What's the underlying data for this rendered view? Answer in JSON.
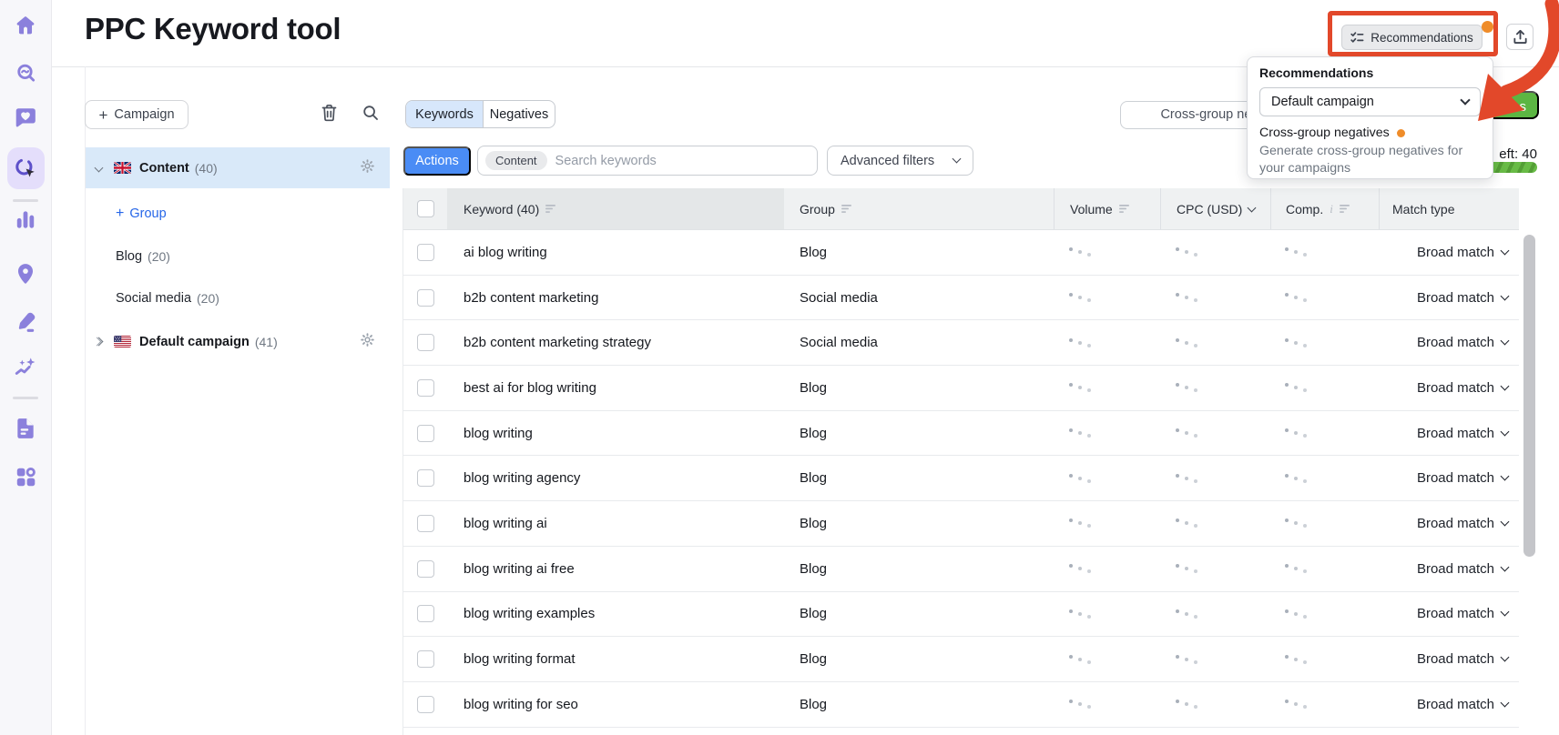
{
  "app": {
    "title": "PPC Keyword tool"
  },
  "topbar": {
    "recommendations_button": {
      "label": "Recommendations",
      "icon": "checklist-icon",
      "has_notification_dot": true
    },
    "export_button": {
      "icon": "export-icon"
    }
  },
  "recommendations_popup": {
    "title": "Recommendations",
    "campaign_select": {
      "value": "Default campaign"
    },
    "recommendation": {
      "title": "Cross-group negatives",
      "has_notification_dot": true,
      "description": "Generate cross-group negatives for your campaigns"
    }
  },
  "sidebar": {
    "active": "ppc-tool-icon",
    "icons": [
      "home-icon",
      "keyword-research-icon",
      "favorites-icon",
      "ppc-tool-icon",
      "bar-chart-icon",
      "location-pin-icon",
      "content-editor-icon",
      "ai-insights-icon",
      "reports-icon",
      "apps-grid-icon"
    ]
  },
  "tree_panel": {
    "campaign_button_label": "Campaign",
    "add_group_label": "Group",
    "campaigns": [
      {
        "name": "Content",
        "count": "(40)",
        "flag": "uk",
        "selected": true,
        "expanded": true,
        "groups": [
          {
            "name": "Blog",
            "count": "(20)"
          },
          {
            "name": "Social media",
            "count": "(20)"
          }
        ]
      },
      {
        "name": "Default campaign",
        "count": "(41)",
        "flag": "us",
        "selected": false,
        "expanded": false
      }
    ]
  },
  "toolbar": {
    "tabs": [
      {
        "label": "Keywords",
        "active": true
      },
      {
        "label": "Negatives",
        "active": false
      }
    ],
    "actions_button": "Actions",
    "search": {
      "chip": "Content",
      "placeholder": "Search keywords"
    },
    "advanced_filters_button": "Advanced filters",
    "cross_group_button_visible_text": "Cross-group negat"
  },
  "quota": {
    "button_visible_text": "s",
    "label_visible_text": "eft: 40"
  },
  "table": {
    "columns": [
      "Keyword (40)",
      "Group",
      "Volume",
      "CPC (USD)",
      "Comp.",
      "Match type"
    ],
    "metric_placeholder": "loading-dots",
    "rows": [
      {
        "keyword": "ai blog writing",
        "group": "Blog",
        "match_type": "Broad match"
      },
      {
        "keyword": "b2b content marketing",
        "group": "Social media",
        "match_type": "Broad match"
      },
      {
        "keyword": "b2b content marketing strategy",
        "group": "Social media",
        "match_type": "Broad match"
      },
      {
        "keyword": "best ai for blog writing",
        "group": "Blog",
        "match_type": "Broad match"
      },
      {
        "keyword": "blog writing",
        "group": "Blog",
        "match_type": "Broad match"
      },
      {
        "keyword": "blog writing agency",
        "group": "Blog",
        "match_type": "Broad match"
      },
      {
        "keyword": "blog writing ai",
        "group": "Blog",
        "match_type": "Broad match"
      },
      {
        "keyword": "blog writing ai free",
        "group": "Blog",
        "match_type": "Broad match"
      },
      {
        "keyword": "blog writing examples",
        "group": "Blog",
        "match_type": "Broad match"
      },
      {
        "keyword": "blog writing format",
        "group": "Blog",
        "match_type": "Broad match"
      },
      {
        "keyword": "blog writing for seo",
        "group": "Blog",
        "match_type": "Broad match"
      }
    ]
  },
  "colors": {
    "accent_blue": "#4a8cf5",
    "selected_blue": "#d7e7fb",
    "sidebar_purple": "#8b80dc",
    "annotation_red": "#e2482a",
    "notification_orange": "#ef8c2a",
    "success_green": "#5cb643"
  }
}
